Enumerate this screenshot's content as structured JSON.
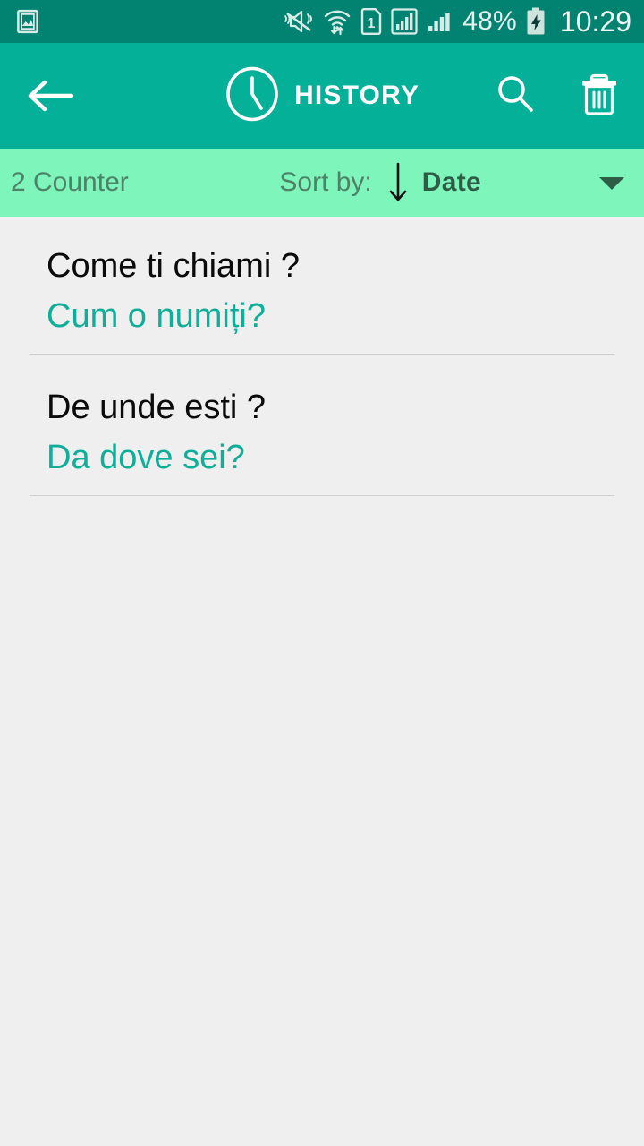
{
  "status_bar": {
    "left_icons": [
      {
        "name": "gallery-icon",
        "label": "Gallery"
      }
    ],
    "right_icons": [
      {
        "name": "mute-vibrate-icon",
        "label": "Silent / vibrate"
      },
      {
        "name": "wifi-transfer-icon",
        "label": "Wi-Fi data transfer"
      },
      {
        "name": "sim-1-icon",
        "label": "SIM 1"
      },
      {
        "name": "signal-bars-sim1-icon",
        "label": "Signal SIM 1"
      },
      {
        "name": "signal-bars-sim2-icon",
        "label": "Signal SIM 2"
      }
    ],
    "sim_number": "1",
    "battery_percent": "48%",
    "battery_state": "charging",
    "time": "10:29",
    "background_color": "#028372",
    "foreground_color": "#e4f1ee"
  },
  "app_bar": {
    "back_label": "Back",
    "clock_icon": "clock-icon",
    "title": "HISTORY",
    "search_label": "Search",
    "delete_label": "Delete all",
    "background_color": "#05b098",
    "title_color": "#ffffff"
  },
  "sort_bar": {
    "counter_text": "2 Counter",
    "sort_by_label": "Sort by:",
    "direction": "descending",
    "sort_value": "Date",
    "dropdown_icon": "chevron-down-icon",
    "background_color": "#7df5bb",
    "text_color": "#4d8266",
    "value_color": "#2e5c45"
  },
  "history": {
    "items": [
      {
        "source_text": "Come ti chiami ?",
        "target_text": "Cum o numiți?"
      },
      {
        "source_text": "De unde esti ?",
        "target_text": "Da dove sei?"
      }
    ],
    "source_color": "#0b0b0b",
    "target_color": "#0fae99",
    "background_color": "#efefef"
  }
}
